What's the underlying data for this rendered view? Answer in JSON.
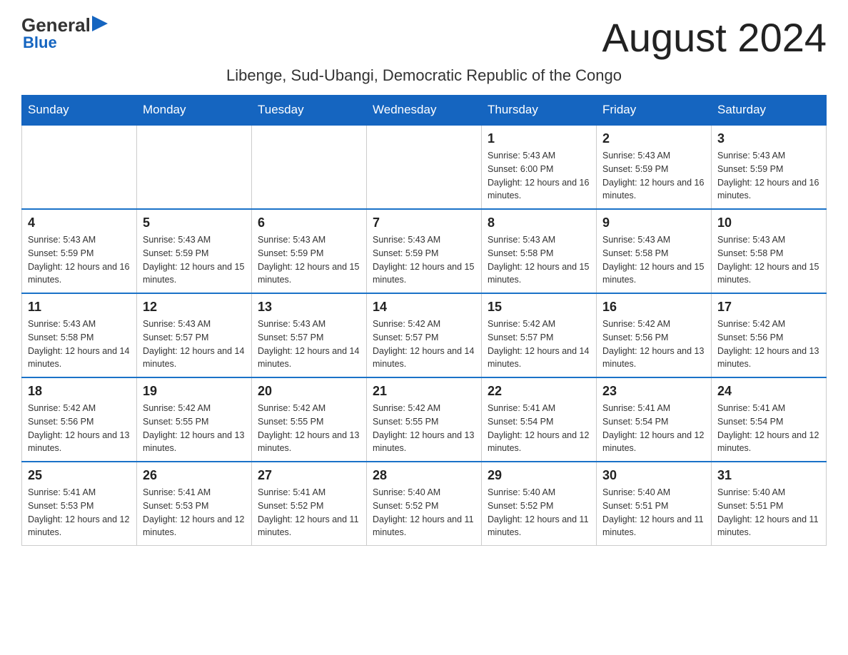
{
  "header": {
    "logo_general": "General",
    "logo_blue": "Blue",
    "logo_arrow": "▶",
    "month_title": "August 2024",
    "location": "Libenge, Sud-Ubangi, Democratic Republic of the Congo"
  },
  "weekdays": [
    "Sunday",
    "Monday",
    "Tuesday",
    "Wednesday",
    "Thursday",
    "Friday",
    "Saturday"
  ],
  "weeks": [
    [
      {
        "day": "",
        "info": ""
      },
      {
        "day": "",
        "info": ""
      },
      {
        "day": "",
        "info": ""
      },
      {
        "day": "",
        "info": ""
      },
      {
        "day": "1",
        "info": "Sunrise: 5:43 AM\nSunset: 6:00 PM\nDaylight: 12 hours and 16 minutes."
      },
      {
        "day": "2",
        "info": "Sunrise: 5:43 AM\nSunset: 5:59 PM\nDaylight: 12 hours and 16 minutes."
      },
      {
        "day": "3",
        "info": "Sunrise: 5:43 AM\nSunset: 5:59 PM\nDaylight: 12 hours and 16 minutes."
      }
    ],
    [
      {
        "day": "4",
        "info": "Sunrise: 5:43 AM\nSunset: 5:59 PM\nDaylight: 12 hours and 16 minutes."
      },
      {
        "day": "5",
        "info": "Sunrise: 5:43 AM\nSunset: 5:59 PM\nDaylight: 12 hours and 15 minutes."
      },
      {
        "day": "6",
        "info": "Sunrise: 5:43 AM\nSunset: 5:59 PM\nDaylight: 12 hours and 15 minutes."
      },
      {
        "day": "7",
        "info": "Sunrise: 5:43 AM\nSunset: 5:59 PM\nDaylight: 12 hours and 15 minutes."
      },
      {
        "day": "8",
        "info": "Sunrise: 5:43 AM\nSunset: 5:58 PM\nDaylight: 12 hours and 15 minutes."
      },
      {
        "day": "9",
        "info": "Sunrise: 5:43 AM\nSunset: 5:58 PM\nDaylight: 12 hours and 15 minutes."
      },
      {
        "day": "10",
        "info": "Sunrise: 5:43 AM\nSunset: 5:58 PM\nDaylight: 12 hours and 15 minutes."
      }
    ],
    [
      {
        "day": "11",
        "info": "Sunrise: 5:43 AM\nSunset: 5:58 PM\nDaylight: 12 hours and 14 minutes."
      },
      {
        "day": "12",
        "info": "Sunrise: 5:43 AM\nSunset: 5:57 PM\nDaylight: 12 hours and 14 minutes."
      },
      {
        "day": "13",
        "info": "Sunrise: 5:43 AM\nSunset: 5:57 PM\nDaylight: 12 hours and 14 minutes."
      },
      {
        "day": "14",
        "info": "Sunrise: 5:42 AM\nSunset: 5:57 PM\nDaylight: 12 hours and 14 minutes."
      },
      {
        "day": "15",
        "info": "Sunrise: 5:42 AM\nSunset: 5:57 PM\nDaylight: 12 hours and 14 minutes."
      },
      {
        "day": "16",
        "info": "Sunrise: 5:42 AM\nSunset: 5:56 PM\nDaylight: 12 hours and 13 minutes."
      },
      {
        "day": "17",
        "info": "Sunrise: 5:42 AM\nSunset: 5:56 PM\nDaylight: 12 hours and 13 minutes."
      }
    ],
    [
      {
        "day": "18",
        "info": "Sunrise: 5:42 AM\nSunset: 5:56 PM\nDaylight: 12 hours and 13 minutes."
      },
      {
        "day": "19",
        "info": "Sunrise: 5:42 AM\nSunset: 5:55 PM\nDaylight: 12 hours and 13 minutes."
      },
      {
        "day": "20",
        "info": "Sunrise: 5:42 AM\nSunset: 5:55 PM\nDaylight: 12 hours and 13 minutes."
      },
      {
        "day": "21",
        "info": "Sunrise: 5:42 AM\nSunset: 5:55 PM\nDaylight: 12 hours and 13 minutes."
      },
      {
        "day": "22",
        "info": "Sunrise: 5:41 AM\nSunset: 5:54 PM\nDaylight: 12 hours and 12 minutes."
      },
      {
        "day": "23",
        "info": "Sunrise: 5:41 AM\nSunset: 5:54 PM\nDaylight: 12 hours and 12 minutes."
      },
      {
        "day": "24",
        "info": "Sunrise: 5:41 AM\nSunset: 5:54 PM\nDaylight: 12 hours and 12 minutes."
      }
    ],
    [
      {
        "day": "25",
        "info": "Sunrise: 5:41 AM\nSunset: 5:53 PM\nDaylight: 12 hours and 12 minutes."
      },
      {
        "day": "26",
        "info": "Sunrise: 5:41 AM\nSunset: 5:53 PM\nDaylight: 12 hours and 12 minutes."
      },
      {
        "day": "27",
        "info": "Sunrise: 5:41 AM\nSunset: 5:52 PM\nDaylight: 12 hours and 11 minutes."
      },
      {
        "day": "28",
        "info": "Sunrise: 5:40 AM\nSunset: 5:52 PM\nDaylight: 12 hours and 11 minutes."
      },
      {
        "day": "29",
        "info": "Sunrise: 5:40 AM\nSunset: 5:52 PM\nDaylight: 12 hours and 11 minutes."
      },
      {
        "day": "30",
        "info": "Sunrise: 5:40 AM\nSunset: 5:51 PM\nDaylight: 12 hours and 11 minutes."
      },
      {
        "day": "31",
        "info": "Sunrise: 5:40 AM\nSunset: 5:51 PM\nDaylight: 12 hours and 11 minutes."
      }
    ]
  ]
}
